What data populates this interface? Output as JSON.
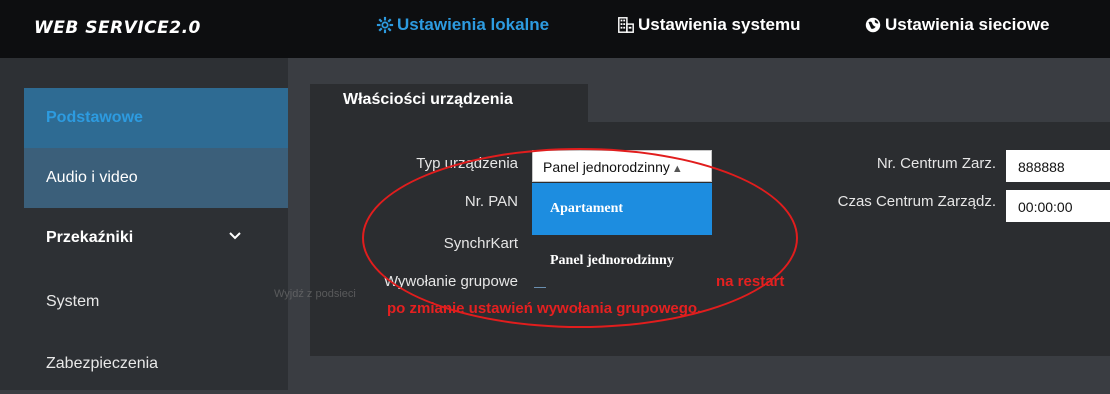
{
  "header": {
    "logo": "WEB SERVICE2.0",
    "nav": [
      {
        "label": "Ustawienia lokalne",
        "icon": "gear-icon",
        "active": true
      },
      {
        "label": "Ustawienia systemu",
        "icon": "building-icon",
        "active": false
      },
      {
        "label": "Ustawienia sieciowe",
        "icon": "globe-icon",
        "active": false
      }
    ]
  },
  "sidebar": {
    "items": [
      {
        "label": "Podstawowe",
        "state": "selected"
      },
      {
        "label": "Audio i video",
        "state": "sub"
      },
      {
        "label": "Przekaźniki",
        "state": "expandable",
        "icon": "chevron-down-icon"
      },
      {
        "label": "System",
        "state": "normal"
      },
      {
        "label": "Zabezpieczenia",
        "state": "normal"
      }
    ]
  },
  "main": {
    "tab": "Właściości urządzenia",
    "fields": {
      "device_type_label": "Typ urządzenia",
      "device_type_value": "Panel jednorodzinny",
      "pan_label": "Nr. PAN",
      "sync_label": "SynchrKart",
      "group_call_label": "Wywołanie grupowe",
      "mgmt_center_label": "Nr. Centrum Zarz.",
      "mgmt_center_value": "888888",
      "mgmt_time_label": "Czas Centrum Zarządz.",
      "mgmt_time_value": "00:00:00"
    },
    "dropdown_options": [
      "Apartament",
      "Panel jednorodzinny"
    ],
    "highlighted_option": "Apartament",
    "warning": {
      "line1": "na restart",
      "line2": "po zmianie ustawień wywołania grupowego."
    },
    "ghost_text": "Wyjdź z podsieci"
  },
  "colors": {
    "accent": "#2d9be0",
    "highlight": "#1d8de0",
    "warning": "#e52020",
    "topbar": "#0d0e10",
    "background": "#3a3d42"
  }
}
